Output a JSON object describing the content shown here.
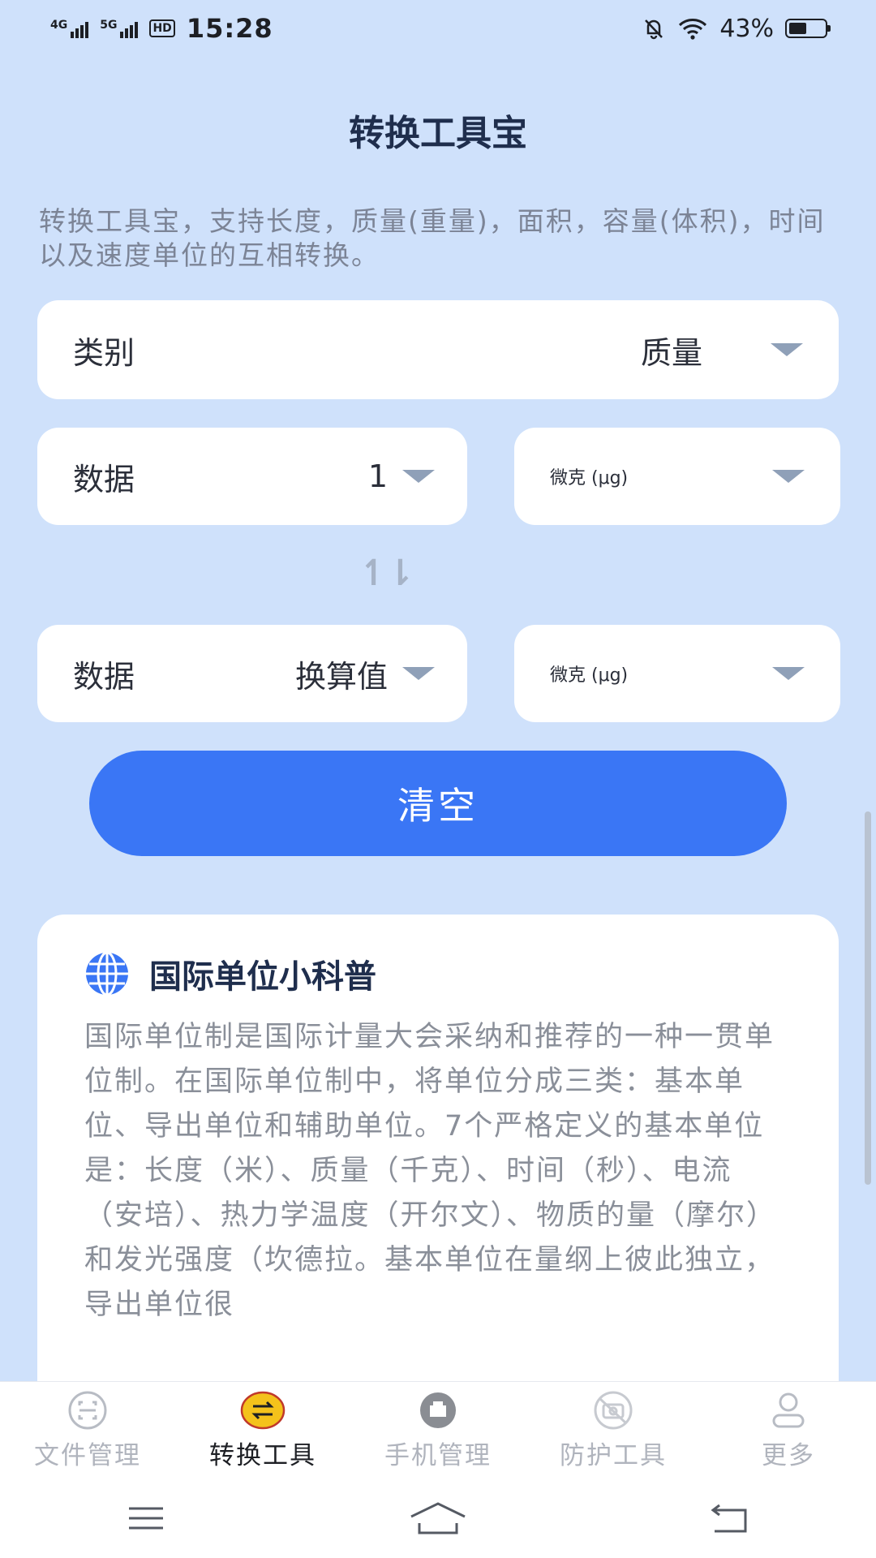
{
  "status_bar": {
    "network_1": "4G",
    "network_2": "5G",
    "hd": "HD",
    "time": "15:28",
    "battery": "43%"
  },
  "page": {
    "title": "转换工具宝",
    "intro": "转换工具宝，支持长度，质量(重量)，面积，容量(体积)，时间以及速度单位的互相转换。"
  },
  "category": {
    "label": "类别",
    "value": "质量"
  },
  "input": {
    "label": "数据",
    "value": "1",
    "unit": "微克 (μg)"
  },
  "output": {
    "label": "数据",
    "value": "换算值",
    "unit": "微克 (μg)"
  },
  "clear_button": "清空",
  "info": {
    "title": "国际单位小科普",
    "body": "国际单位制是国际计量大会采纳和推荐的一种一贯单位制。在国际单位制中，将单位分成三类：基本单位、导出单位和辅助单位。7个严格定义的基本单位是：长度（米）、质量（千克）、时间（秒）、电流（安培）、热力学温度（开尔文）、物质的量（摩尔）和发光强度（坎德拉。基本单位在量纲上彼此独立，导出单位很"
  },
  "tabs": [
    {
      "label": "文件管理",
      "icon": "file-scan-icon",
      "active": false
    },
    {
      "label": "转换工具",
      "icon": "convert-icon",
      "active": true
    },
    {
      "label": "手机管理",
      "icon": "phone-manage-icon",
      "active": false
    },
    {
      "label": "防护工具",
      "icon": "camera-block-icon",
      "active": false
    },
    {
      "label": "更多",
      "icon": "user-icon",
      "active": false
    }
  ],
  "colors": {
    "background": "#cfe1fb",
    "accent": "#3a76f5",
    "active_tab_icon": "#f4c21b"
  }
}
